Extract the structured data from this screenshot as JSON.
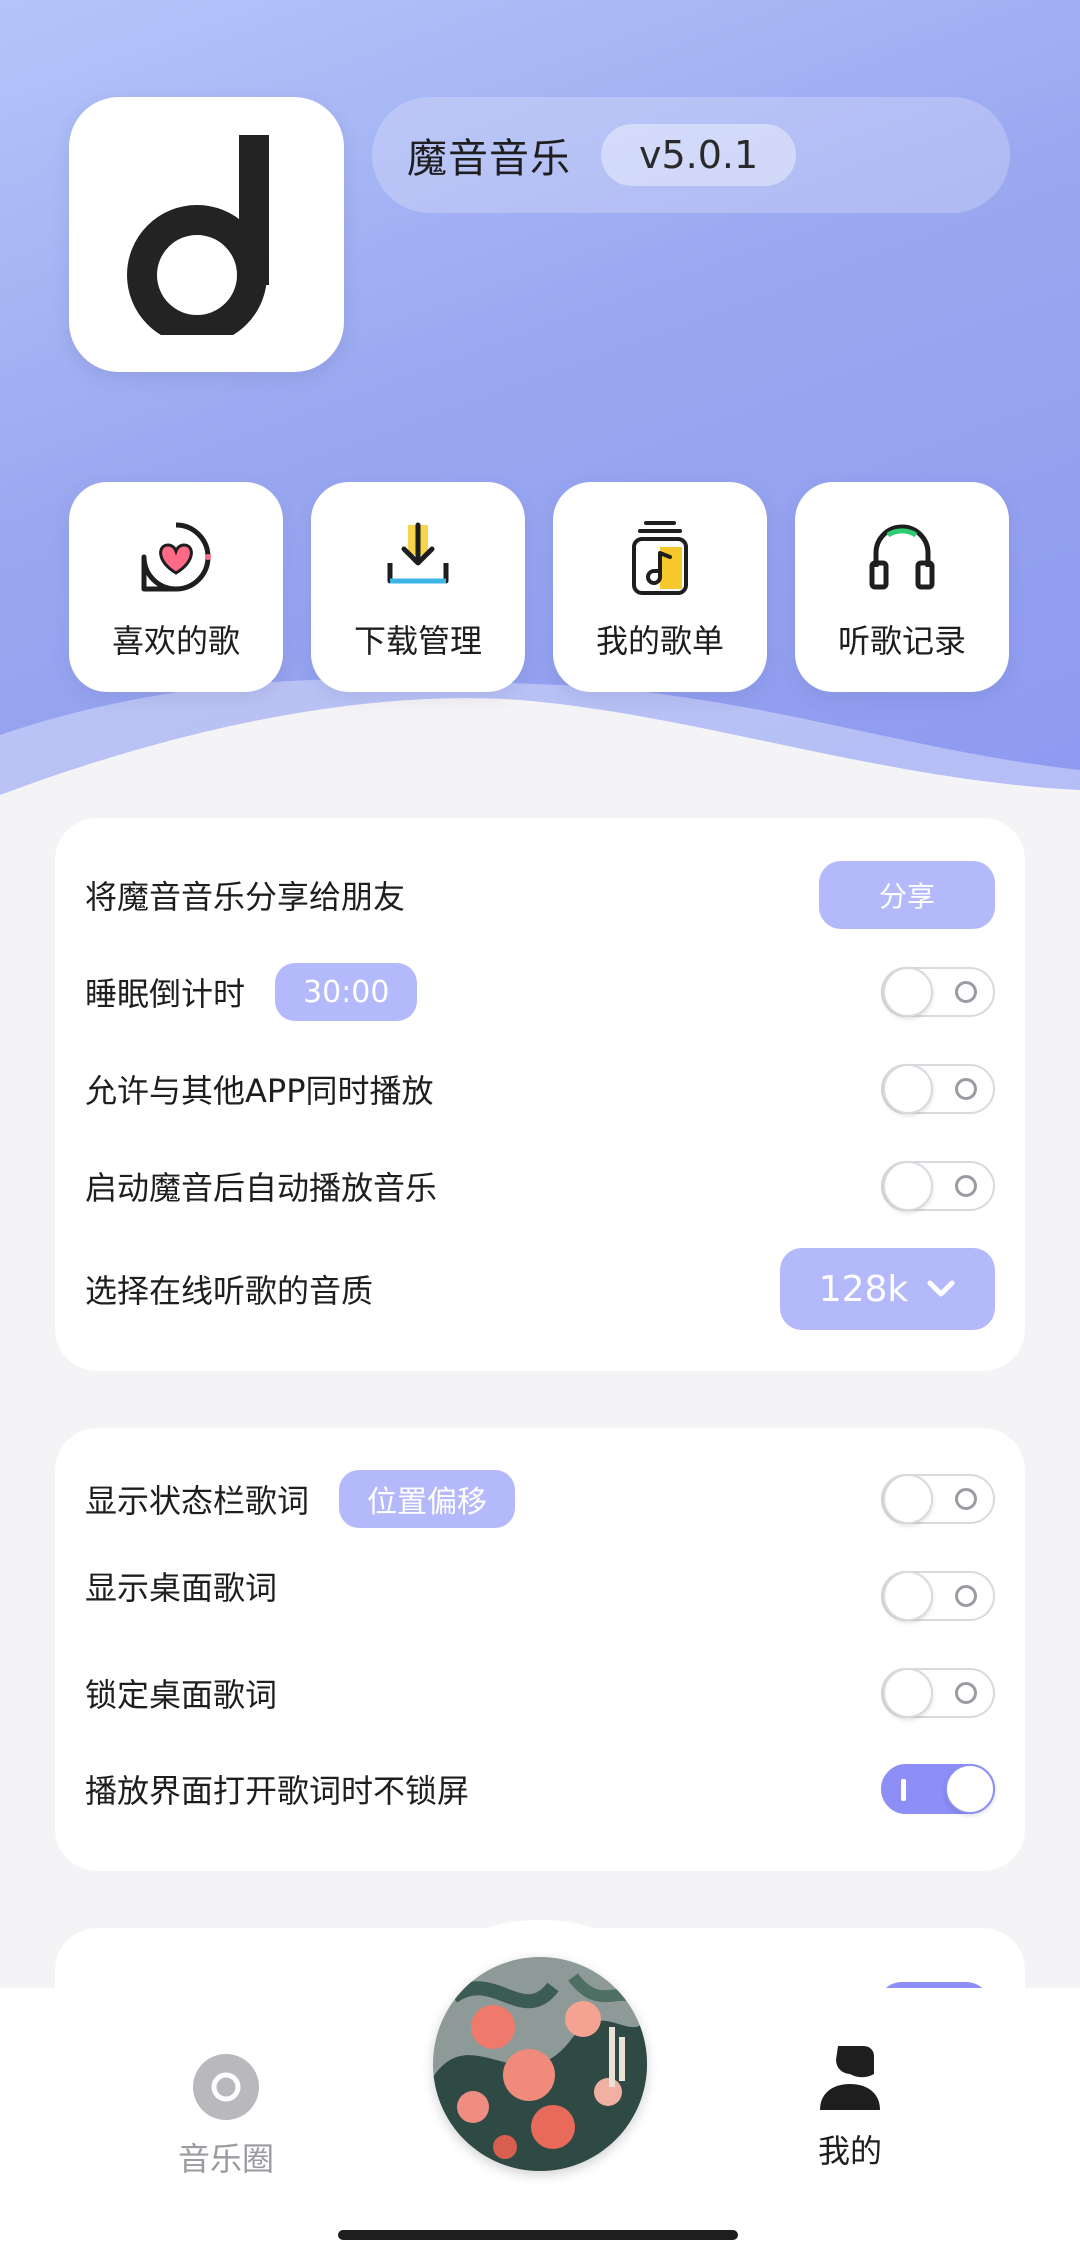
{
  "app": {
    "name": "魔音音乐",
    "version": "v5.0.1"
  },
  "quick_actions": [
    {
      "label": "喜欢的歌",
      "icon": "heart-chat-icon"
    },
    {
      "label": "下载管理",
      "icon": "download-icon"
    },
    {
      "label": "我的歌单",
      "icon": "playlist-icon"
    },
    {
      "label": "听歌记录",
      "icon": "headphones-icon"
    }
  ],
  "settings1": {
    "share": {
      "label": "将魔音音乐分享给朋友",
      "button": "分享"
    },
    "sleep": {
      "label": "睡眠倒计时",
      "tag": "30:00",
      "on": false
    },
    "mix": {
      "label": "允许与其他APP同时播放",
      "on": false
    },
    "autoplay": {
      "label": "启动魔音后自动播放音乐",
      "on": false
    },
    "quality": {
      "label": "选择在线听歌的音质",
      "value": "128k"
    }
  },
  "settings2": {
    "status_lyrics": {
      "label": "显示状态栏歌词",
      "tag": "位置偏移",
      "on": false
    },
    "desktop_lyrics": {
      "label": "显示桌面歌词",
      "on": false
    },
    "lock_desktop": {
      "label": "锁定桌面歌词",
      "on": false
    },
    "no_lock": {
      "label": "播放界面打开歌词时不锁屏",
      "on": true
    }
  },
  "nav": {
    "left": {
      "label": "音乐圈",
      "icon": "music-circle-icon"
    },
    "center": {
      "icon": "album-cover"
    },
    "right": {
      "label": "我的",
      "icon": "profile-icon"
    }
  },
  "colors": {
    "accent": "#8d8ef6",
    "tag": "#b4b9fb",
    "hero_start": "#b5c5fa",
    "hero_end": "#8e9af0"
  }
}
